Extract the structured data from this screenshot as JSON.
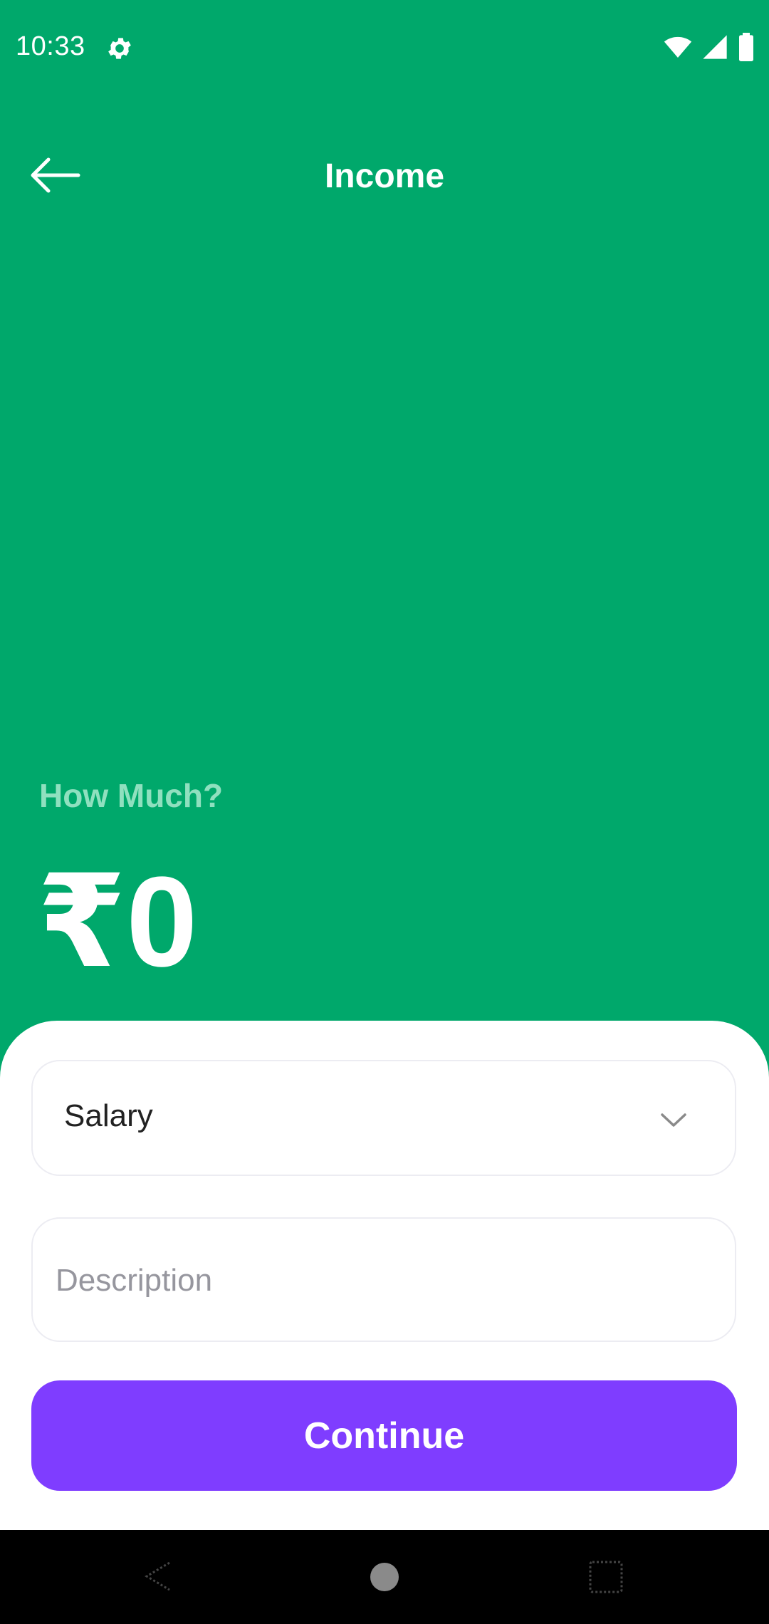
{
  "status_bar": {
    "time": "10:33",
    "icons": [
      "gear-icon",
      "wifi-icon",
      "cell-signal-icon",
      "battery-icon"
    ]
  },
  "app_bar": {
    "title": "Income",
    "back_icon": "arrow-left-icon"
  },
  "amount_section": {
    "prompt": "How Much?",
    "amount": "₹0"
  },
  "form": {
    "category": {
      "selected": "Salary",
      "icon": "chevron-down-icon"
    },
    "description": {
      "placeholder": "Description",
      "value": ""
    },
    "continue_label": "Continue"
  },
  "colors": {
    "background": "#00A86B",
    "button": "#7F3DFF",
    "prompt": "#8FE0BF"
  },
  "nav_bar": {
    "icons": [
      "nav-back-icon",
      "nav-home-icon",
      "nav-recents-icon"
    ]
  }
}
